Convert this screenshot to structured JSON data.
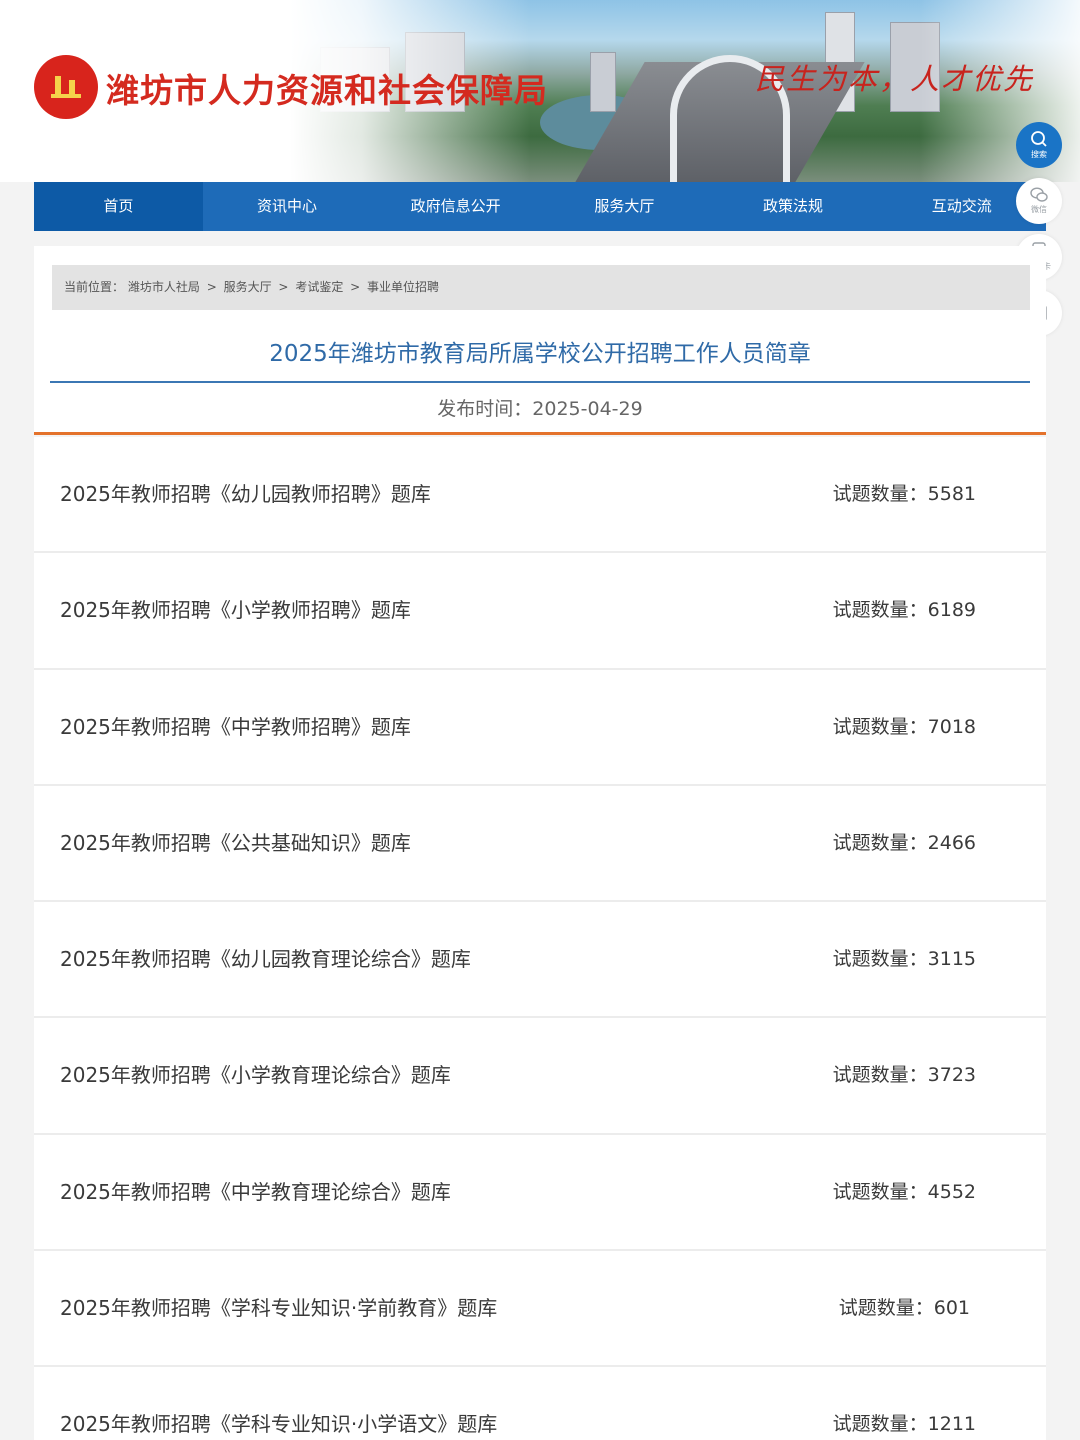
{
  "header": {
    "site_title": "潍坊市人力资源和社会保障局",
    "slogan": "民生为本，人才优先"
  },
  "nav": {
    "items": [
      {
        "label": "首页"
      },
      {
        "label": "资讯中心"
      },
      {
        "label": "政府信息公开"
      },
      {
        "label": "服务大厅"
      },
      {
        "label": "政策法规"
      },
      {
        "label": "互动交流"
      }
    ]
  },
  "side_tools": [
    {
      "icon": "search-icon",
      "label": "搜索"
    },
    {
      "icon": "wechat-icon",
      "label": "微信"
    },
    {
      "icon": "social-card-icon",
      "label": "社保卡"
    },
    {
      "icon": "message-icon",
      "label": ""
    }
  ],
  "breadcrumb": {
    "prefix": "当前位置：",
    "items": [
      "潍坊市人社局",
      "服务大厅",
      "考试鉴定",
      "事业单位招聘"
    ],
    "separator": ">"
  },
  "article": {
    "title": "2025年潍坊市教育局所属学校公开招聘工作人员简章",
    "date_label": "发布时间：",
    "date": "2025-04-29"
  },
  "list": {
    "count_label": "试题数量：",
    "items": [
      {
        "title": "2025年教师招聘《幼儿园教师招聘》题库",
        "count": "5581"
      },
      {
        "title": "2025年教师招聘《小学教师招聘》题库",
        "count": "6189"
      },
      {
        "title": "2025年教师招聘《中学教师招聘》题库",
        "count": "7018"
      },
      {
        "title": "2025年教师招聘《公共基础知识》题库",
        "count": "2466"
      },
      {
        "title": "2025年教师招聘《幼儿园教育理论综合》题库",
        "count": "3115"
      },
      {
        "title": "2025年教师招聘《小学教育理论综合》题库",
        "count": "3723"
      },
      {
        "title": "2025年教师招聘《中学教育理论综合》题库",
        "count": "4552"
      },
      {
        "title": "2025年教师招聘《学科专业知识·学前教育》题库",
        "count": "601"
      },
      {
        "title": "2025年教师招聘《学科专业知识·小学语文》题库",
        "count": "1211"
      }
    ]
  },
  "colors": {
    "nav_blue": "#1e6bb8",
    "title_red": "#d42a1f",
    "article_title_blue": "#2f6aa7",
    "accent_orange": "#e4722b"
  }
}
